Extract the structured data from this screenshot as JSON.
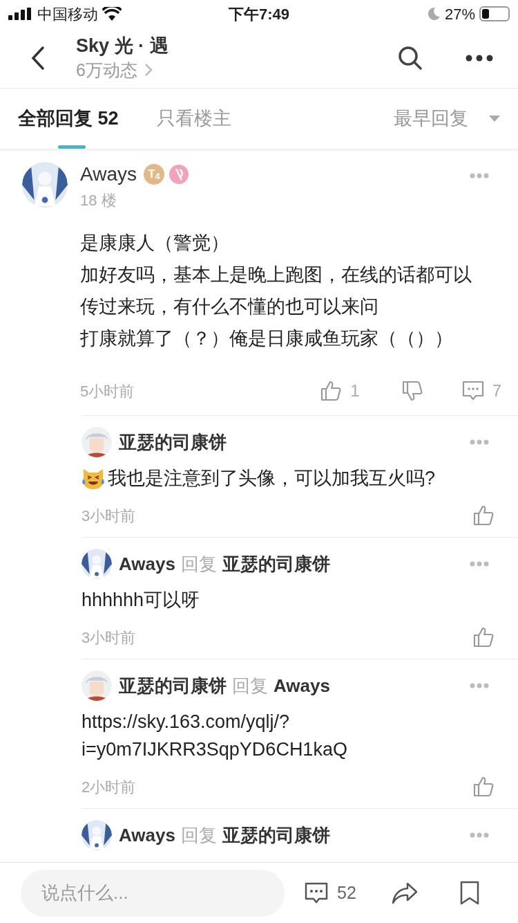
{
  "status_bar": {
    "carrier": "中国移动",
    "time": "下午7:49",
    "battery": "27%"
  },
  "header": {
    "title": "Sky 光 · 遇",
    "subtitle": "6万动态"
  },
  "tabs": [
    {
      "label": "全部回复",
      "count": "52",
      "selected": true
    },
    {
      "label": "只看楼主",
      "selected": false
    }
  ],
  "sort": {
    "label": "最早回复"
  },
  "post": {
    "author": "Aways",
    "level_badge": "T$_{4}$",
    "floor": "18 楼",
    "body_lines": [
      "是康康人（警觉）",
      "加好友吗，基本上是晚上跑图，在线的话都可以传过来玩，有什么不懂的也可以来问",
      "打康就算了（？）俺是日康咸鱼玩家（（））"
    ],
    "time": "5小时前",
    "likes": "1",
    "comments": "7"
  },
  "replies": [
    {
      "author": "亚瑟的司康饼",
      "has_emoji": true,
      "text": "我也是注意到了头像，可以加我互火吗?",
      "time": "3小时前"
    },
    {
      "author": "Aways",
      "reply_word": "回复",
      "reply_to": "亚瑟的司康饼",
      "has_emoji": false,
      "text": "hhhhhh可以呀",
      "time": "3小时前"
    },
    {
      "author": "亚瑟的司康饼",
      "reply_word": "回复",
      "reply_to": "Aways",
      "has_emoji": false,
      "text": "https://sky.163.com/yqlj/?\ni=y0m7IJKRR3SqpYD6CH1kaQ",
      "time": "2小时前"
    },
    {
      "author": "Aways",
      "reply_word": "回复",
      "reply_to": "亚瑟的司康饼",
      "has_emoji": false
    }
  ],
  "bottom_bar": {
    "placeholder": "说点什么...",
    "comment_count": "52"
  }
}
